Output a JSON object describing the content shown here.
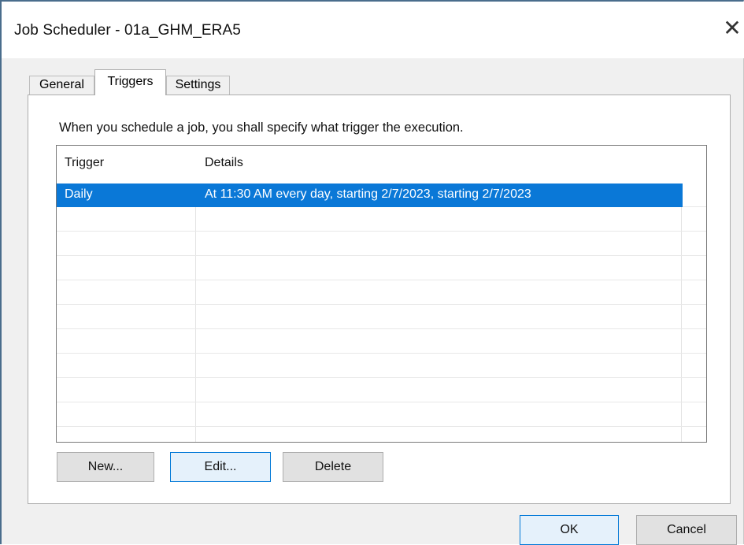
{
  "window": {
    "title": "Job Scheduler - 01a_GHM_ERA5",
    "close_glyph": "✕"
  },
  "tabs": [
    {
      "label": "General",
      "selected": false
    },
    {
      "label": "Triggers",
      "selected": true
    },
    {
      "label": "Settings",
      "selected": false
    }
  ],
  "triggers_panel": {
    "description": "When you schedule a job, you shall specify what trigger the execution.",
    "columns": [
      "Trigger",
      "Details"
    ],
    "rows": [
      {
        "trigger": "Daily",
        "details": "At 11:30 AM every day, starting 2/7/2023, starting 2/7/2023",
        "selected": true
      }
    ],
    "buttons": {
      "new": "New...",
      "edit": "Edit...",
      "delete": "Delete"
    }
  },
  "footer": {
    "ok": "OK",
    "cancel": "Cancel"
  },
  "colors": {
    "selection": "#0a78d7",
    "focus_border": "#0078d7"
  }
}
